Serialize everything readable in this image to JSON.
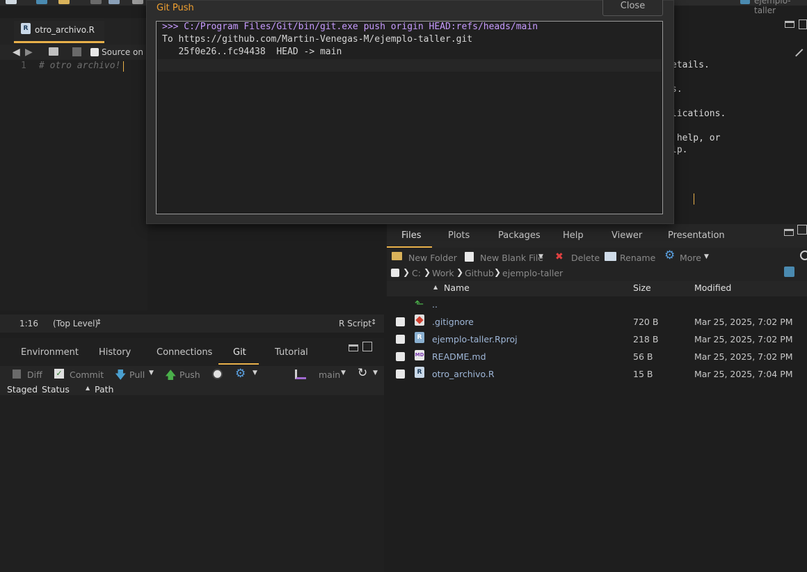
{
  "editor": {
    "tab_label": "otro_archivo.R",
    "source_on_save_label": "Source on S",
    "line_number": "1",
    "code_line": "# otro archivo!"
  },
  "status_bar": {
    "position": "1:16",
    "scope": "(Top Level)",
    "file_type": "R Script"
  },
  "console": {
    "fragments": [
      "etails.",
      "s.",
      "lications.",
      " help, or",
      "lp."
    ]
  },
  "dialog": {
    "title": "Git Push",
    "close_label": "Close",
    "output": [
      ">>> C:/Program Files/Git/bin/git.exe push origin HEAD:refs/heads/main",
      "To https://github.com/Martin-Venegas-M/ejemplo-taller.git",
      "   25f0e26..fc94438  HEAD -> main"
    ]
  },
  "lower_left": {
    "tabs": [
      "Environment",
      "History",
      "Connections",
      "Git",
      "Tutorial"
    ],
    "active_tab": "Git",
    "toolbar": {
      "diff": "Diff",
      "commit": "Commit",
      "pull": "Pull",
      "push": "Push",
      "branch": "main"
    },
    "columns": [
      "Staged",
      "Status",
      "Path"
    ]
  },
  "files": {
    "tabs": [
      "Files",
      "Plots",
      "Packages",
      "Help",
      "Viewer",
      "Presentation"
    ],
    "active_tab": "Files",
    "toolbar": {
      "new_folder": "New Folder",
      "new_blank_file": "New Blank File",
      "delete": "Delete",
      "rename": "Rename",
      "more": "More"
    },
    "breadcrumb": [
      "C:",
      "Work",
      "Github",
      "ejemplo-taller"
    ],
    "columns": {
      "name": "Name",
      "size": "Size",
      "modified": "Modified"
    },
    "parent_dir": "..",
    "rows": [
      {
        "name": ".gitignore",
        "size": "720 B",
        "modified": "Mar 25, 2025, 7:02 PM",
        "icon": "gitignore-file-icon"
      },
      {
        "name": "ejemplo-taller.Rproj",
        "size": "218 B",
        "modified": "Mar 25, 2025, 7:02 PM",
        "icon": "rproj-file-icon"
      },
      {
        "name": "README.md",
        "size": "56 B",
        "modified": "Mar 25, 2025, 7:02 PM",
        "icon": "markdown-file-icon"
      },
      {
        "name": "otro_archivo.R",
        "size": "15 B",
        "modified": "Mar 25, 2025, 7:04 PM",
        "icon": "r-file-icon"
      }
    ]
  },
  "project_label": "ejemplo-taller",
  "colors": {
    "accent": "#e8b04a",
    "dialog_title": "#f0a030",
    "command_text": "#c79bff",
    "link_text": "#9fb7d8"
  }
}
